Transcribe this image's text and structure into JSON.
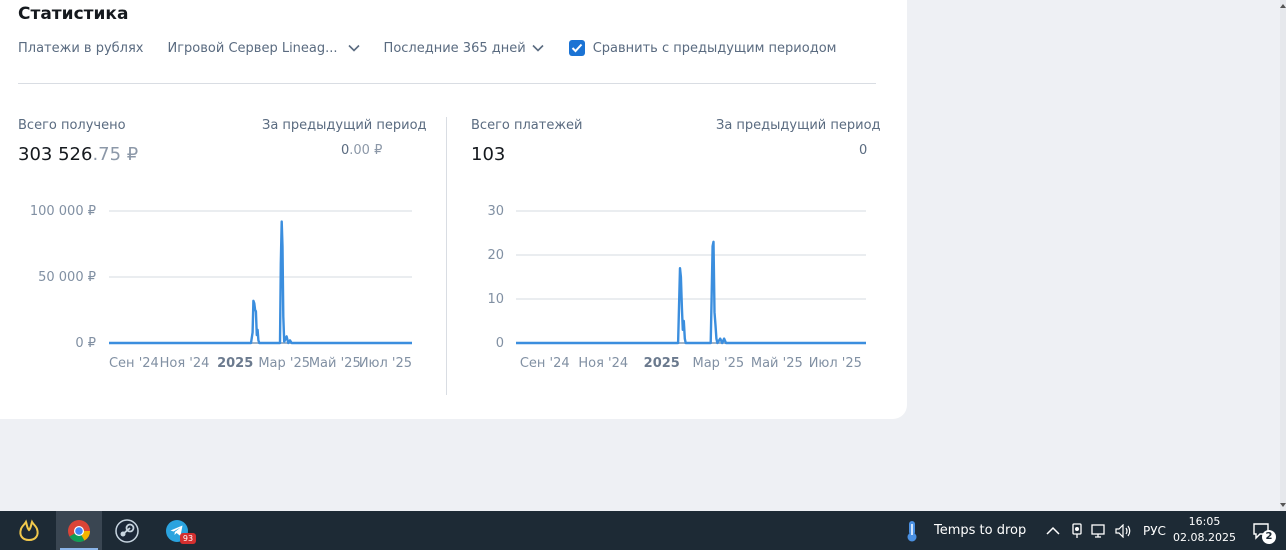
{
  "page": {
    "title": "Статистика"
  },
  "filters": {
    "currency": "Платежи в рублях",
    "server": "Игровой Сервер Lineag...",
    "period": "Последние 365 дней",
    "compare_label": "Сравнить с предыдущим периодом",
    "compare_checked": true
  },
  "left_panel": {
    "total_label": "Всего получено",
    "total_int": "303 526",
    "total_frac": ".75 ₽",
    "prev_label": "За предыдущий период",
    "prev_int": "0",
    "prev_frac": ".00 ₽"
  },
  "right_panel": {
    "total_label": "Всего платежей",
    "total_value": "103",
    "prev_label": "За предыдущий период",
    "prev_value": "0"
  },
  "chart_data": [
    {
      "type": "line",
      "title": "",
      "xlabel": "",
      "ylabel": "",
      "ylim": [
        0,
        100000
      ],
      "yticks": [
        "100 000 ₽",
        "50 000 ₽",
        "0 ₽"
      ],
      "ytick_values": [
        100000,
        50000,
        0
      ],
      "xlim": [
        "2024-08-02",
        "2025-08-02"
      ],
      "xticks": [
        {
          "label": "Сен '24",
          "date": "2024-09-01",
          "bold": false
        },
        {
          "label": "Ноя '24",
          "date": "2024-11-01",
          "bold": false
        },
        {
          "label": "2025",
          "date": "2025-01-01",
          "bold": true
        },
        {
          "label": "Мар '25",
          "date": "2025-03-01",
          "bold": false
        },
        {
          "label": "Май '25",
          "date": "2025-05-01",
          "bold": false
        },
        {
          "label": "Июл '25",
          "date": "2025-07-01",
          "bold": false
        }
      ],
      "grid": true,
      "legend": "none",
      "series": [
        {
          "color": "#3b8ede",
          "points": [
            [
              "2024-08-02",
              0
            ],
            [
              "2025-01-20",
              0
            ],
            [
              "2025-01-22",
              8000
            ],
            [
              "2025-01-23",
              32000
            ],
            [
              "2025-01-24",
              30000
            ],
            [
              "2025-01-25",
              25000
            ],
            [
              "2025-01-26",
              24000
            ],
            [
              "2025-01-27",
              6000
            ],
            [
              "2025-01-28",
              10000
            ],
            [
              "2025-01-29",
              2000
            ],
            [
              "2025-01-30",
              0
            ],
            [
              "2025-02-24",
              0
            ],
            [
              "2025-02-25",
              60000
            ],
            [
              "2025-02-26",
              92000
            ],
            [
              "2025-02-27",
              73000
            ],
            [
              "2025-02-28",
              20000
            ],
            [
              "2025-03-01",
              1000
            ],
            [
              "2025-03-04",
              5000
            ],
            [
              "2025-03-06",
              0
            ],
            [
              "2025-03-08",
              2000
            ],
            [
              "2025-03-10",
              0
            ],
            [
              "2025-08-02",
              0
            ]
          ]
        }
      ]
    },
    {
      "type": "line",
      "title": "",
      "xlabel": "",
      "ylabel": "",
      "ylim": [
        0,
        30
      ],
      "yticks": [
        "30",
        "20",
        "10",
        "0"
      ],
      "ytick_values": [
        30,
        20,
        10,
        0
      ],
      "xlim": [
        "2024-08-02",
        "2025-08-02"
      ],
      "xticks": [
        {
          "label": "Сен '24",
          "date": "2024-09-01",
          "bold": false
        },
        {
          "label": "Ноя '24",
          "date": "2024-11-01",
          "bold": false
        },
        {
          "label": "2025",
          "date": "2025-01-01",
          "bold": true
        },
        {
          "label": "Мар '25",
          "date": "2025-03-01",
          "bold": false
        },
        {
          "label": "Май '25",
          "date": "2025-05-01",
          "bold": false
        },
        {
          "label": "Июл '25",
          "date": "2025-07-01",
          "bold": false
        }
      ],
      "grid": true,
      "legend": "none",
      "series": [
        {
          "color": "#3b8ede",
          "points": [
            [
              "2024-08-02",
              0
            ],
            [
              "2025-01-18",
              0
            ],
            [
              "2025-01-20",
              17
            ],
            [
              "2025-01-21",
              15
            ],
            [
              "2025-01-22",
              8
            ],
            [
              "2025-01-23",
              3
            ],
            [
              "2025-01-24",
              5
            ],
            [
              "2025-01-25",
              1
            ],
            [
              "2025-01-26",
              0
            ],
            [
              "2025-02-21",
              0
            ],
            [
              "2025-02-22",
              10
            ],
            [
              "2025-02-23",
              22
            ],
            [
              "2025-02-24",
              23
            ],
            [
              "2025-02-25",
              7
            ],
            [
              "2025-02-26",
              4
            ],
            [
              "2025-02-27",
              1
            ],
            [
              "2025-02-28",
              0
            ],
            [
              "2025-03-03",
              1
            ],
            [
              "2025-03-05",
              0
            ],
            [
              "2025-03-07",
              1
            ],
            [
              "2025-03-09",
              0
            ],
            [
              "2025-08-02",
              0
            ]
          ]
        }
      ]
    }
  ],
  "taskbar": {
    "apps": [
      {
        "name": "app-launcher"
      },
      {
        "name": "chrome"
      },
      {
        "name": "steam"
      },
      {
        "name": "telegram",
        "badge": "93"
      }
    ],
    "weather_text": "Temps to drop",
    "language": "РУС",
    "time": "16:05",
    "date": "02.08.2025",
    "notifications": "2"
  }
}
